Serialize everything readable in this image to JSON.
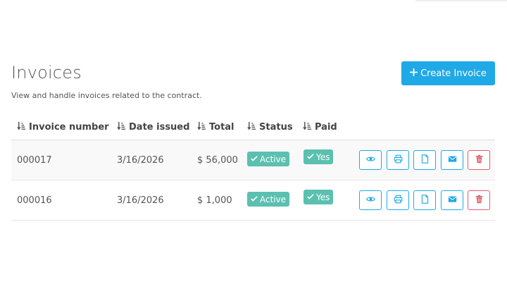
{
  "page": {
    "title": "Invoices",
    "subtitle": "View and handle invoices related to the contract.",
    "create_button_label": "Create Invoice"
  },
  "table": {
    "columns": [
      {
        "label": "Invoice number",
        "sort_icon": "sort-icon"
      },
      {
        "label": "Date issued",
        "sort_icon": "sort-icon"
      },
      {
        "label": "Total",
        "sort_icon": "sort-icon"
      },
      {
        "label": "Status",
        "sort_icon": "sort-icon"
      },
      {
        "label": "Paid",
        "sort_icon": "sort-icon"
      }
    ],
    "rows": [
      {
        "invoice_number": "000017",
        "date_issued": "3/16/2026",
        "total": "$ 56,000",
        "status": "Active",
        "paid": "Yes"
      },
      {
        "invoice_number": "000016",
        "date_issued": "3/16/2026",
        "total": "$ 1,000",
        "status": "Active",
        "paid": "Yes"
      }
    ],
    "row_actions": [
      "eye-icon",
      "print-icon",
      "file-icon",
      "envelope-icon",
      "trash-icon"
    ]
  },
  "colors": {
    "primary": "#1fa9e6",
    "badge": "#5bc0b0",
    "danger": "#e05c66"
  }
}
